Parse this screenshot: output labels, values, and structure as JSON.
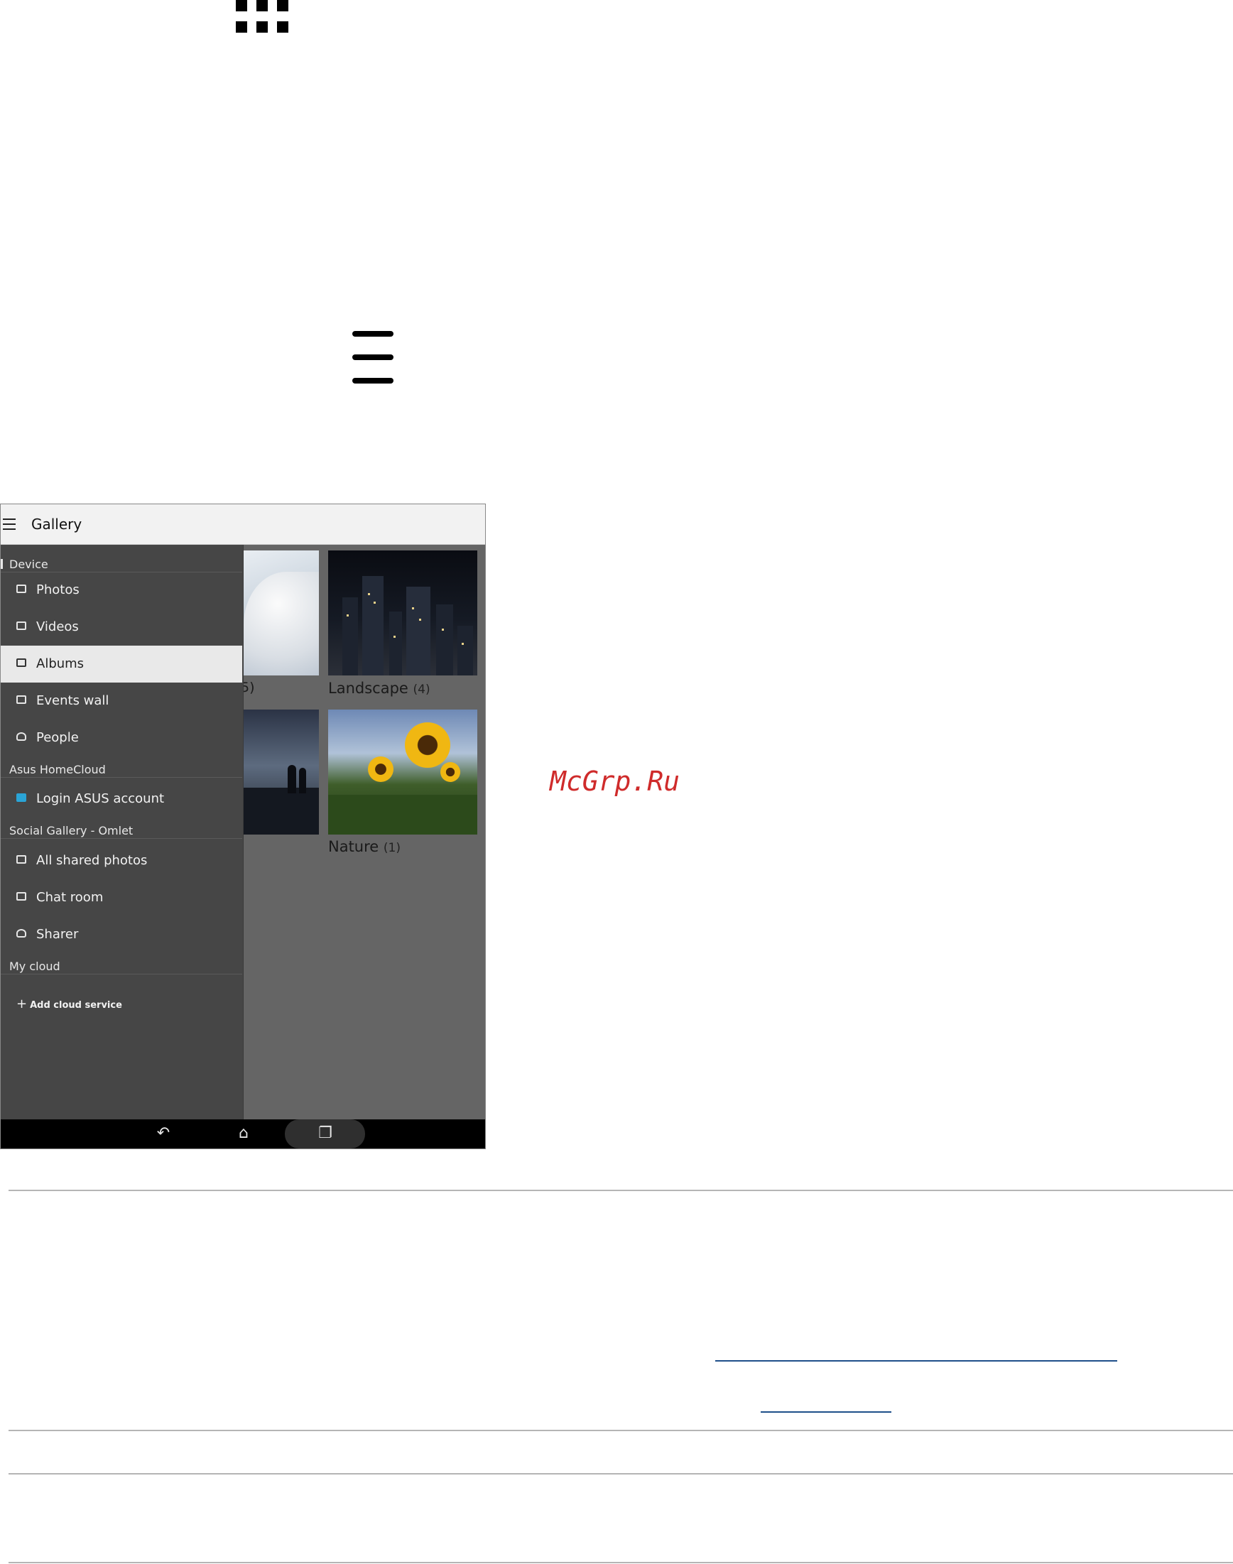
{
  "app": {
    "title": "Gallery"
  },
  "drawer": {
    "sections": [
      {
        "label": "Device",
        "items": [
          {
            "label": "Photos",
            "icon": "photos-icon"
          },
          {
            "label": "Videos",
            "icon": "videos-icon"
          },
          {
            "label": "Albums",
            "icon": "albums-icon",
            "selected": true
          },
          {
            "label": "Events wall",
            "icon": "events-wall-icon"
          },
          {
            "label": "People",
            "icon": "people-icon"
          }
        ]
      },
      {
        "label": "Asus HomeCloud",
        "items": [
          {
            "label": "Login ASUS account",
            "icon": "asus-cloud-icon"
          }
        ]
      },
      {
        "label": "Social Gallery - Omlet",
        "items": [
          {
            "label": "All shared photos",
            "icon": "shared-photos-icon"
          },
          {
            "label": "Chat room",
            "icon": "chat-room-icon"
          },
          {
            "label": "Sharer",
            "icon": "sharer-icon"
          }
        ]
      },
      {
        "label": "My cloud",
        "action": {
          "label": "Add cloud service",
          "icon": "plus-icon"
        }
      }
    ]
  },
  "albums": [
    {
      "name": "Landscape",
      "count": "(4)"
    },
    {
      "name": "Nature",
      "count": "(1)"
    }
  ],
  "partial_caption": "5)",
  "navbar": {
    "back": "back-icon",
    "home": "home-icon",
    "recents": "recent-apps-icon"
  },
  "watermark": "McGrp.Ru",
  "colors": {
    "drawer_bg": "#464646",
    "content_bg": "#656565",
    "selected_item_bg": "#e9e9e9",
    "watermark": "#cf2b2b",
    "link": "#1e4f8a"
  }
}
